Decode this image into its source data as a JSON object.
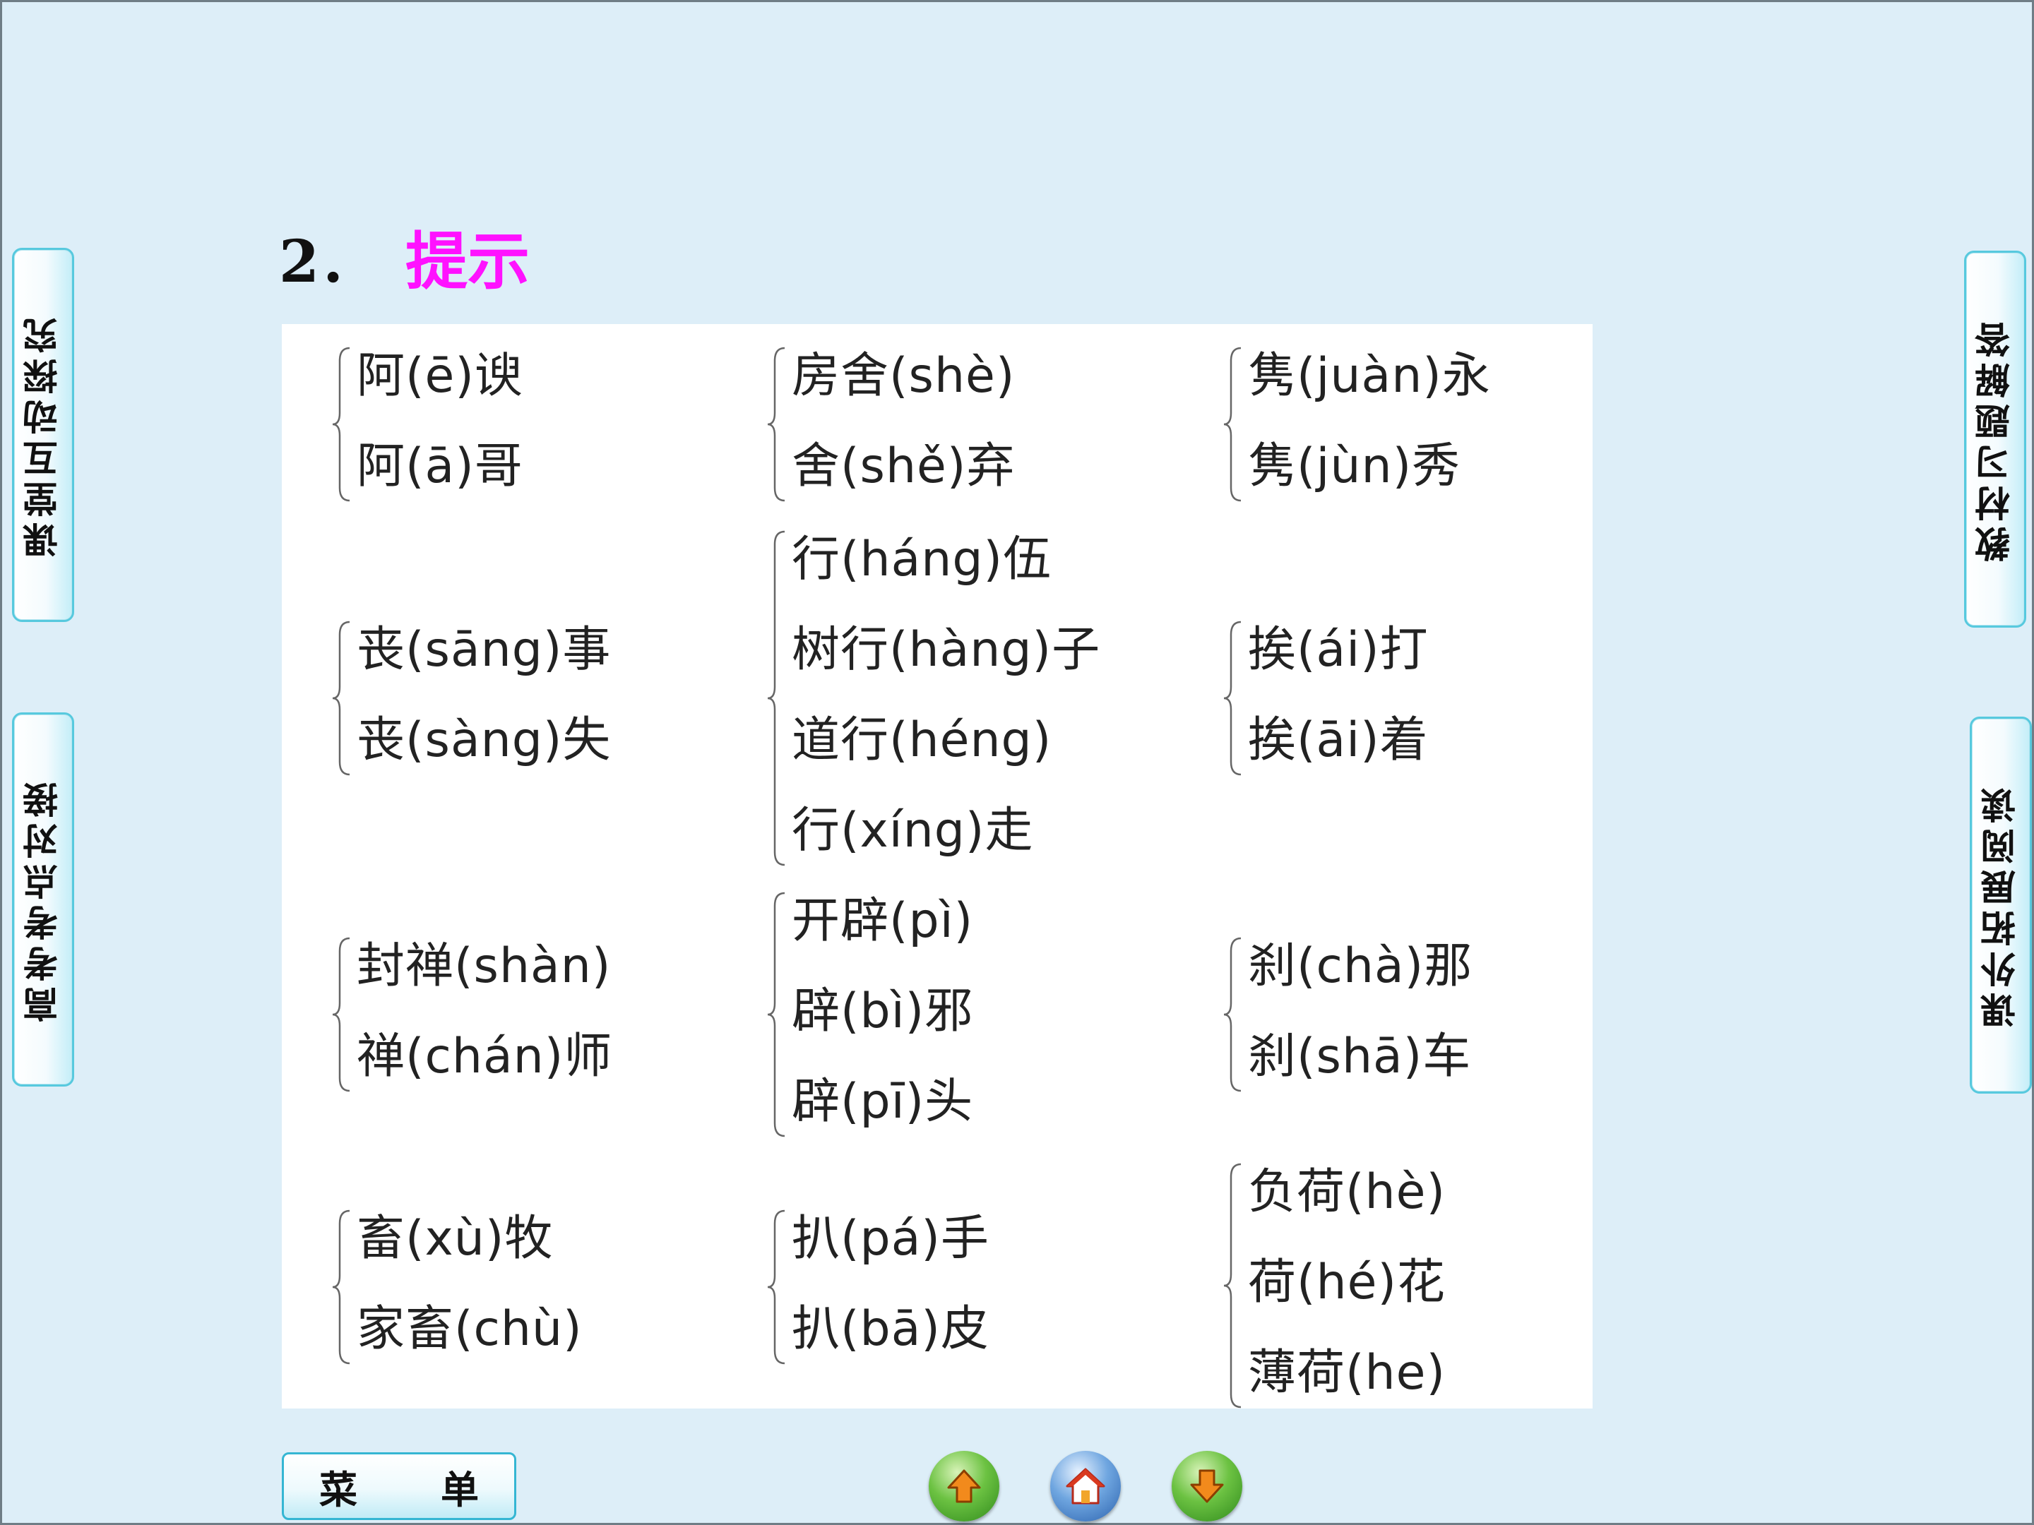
{
  "side_tabs": {
    "left_top": "课堂互动探究",
    "left_bottom": "高考考点对接",
    "right_top": "教材习题解答",
    "right_bottom": "课外拓展阅读"
  },
  "heading": {
    "number": "2．",
    "title": "提示"
  },
  "groups": [
    {
      "items": [
        "阿(ē)谀",
        "阿(ā)哥"
      ]
    },
    {
      "items": [
        "房舍(shè)",
        "舍(shě)弃"
      ]
    },
    {
      "items": [
        "隽(juàn)永",
        "隽(jùn)秀"
      ]
    },
    {
      "items": [
        "丧(sāng)事",
        "丧(sàng)失"
      ]
    },
    {
      "items": [
        "行(háng)伍",
        "树行(hàng)子",
        "道行(héng)",
        "行(xíng)走"
      ]
    },
    {
      "items": [
        "挨(ái)打",
        "挨(āi)着"
      ]
    },
    {
      "items": [
        "封禅(shàn)",
        "禅(chán)师"
      ]
    },
    {
      "items": [
        "开辟(pì)",
        "辟(bì)邪",
        "辟(pī)头"
      ]
    },
    {
      "items": [
        "刹(chà)那",
        "刹(shā)车"
      ]
    },
    {
      "items": [
        "畜(xù)牧",
        "家畜(chù)"
      ]
    },
    {
      "items": [
        "扒(pá)手",
        "扒(bā)皮"
      ]
    },
    {
      "items": [
        "负荷(hè)",
        "荷(hé)花",
        "薄荷(he)"
      ]
    }
  ],
  "bottom_nav": {
    "menu_label": "菜单"
  }
}
